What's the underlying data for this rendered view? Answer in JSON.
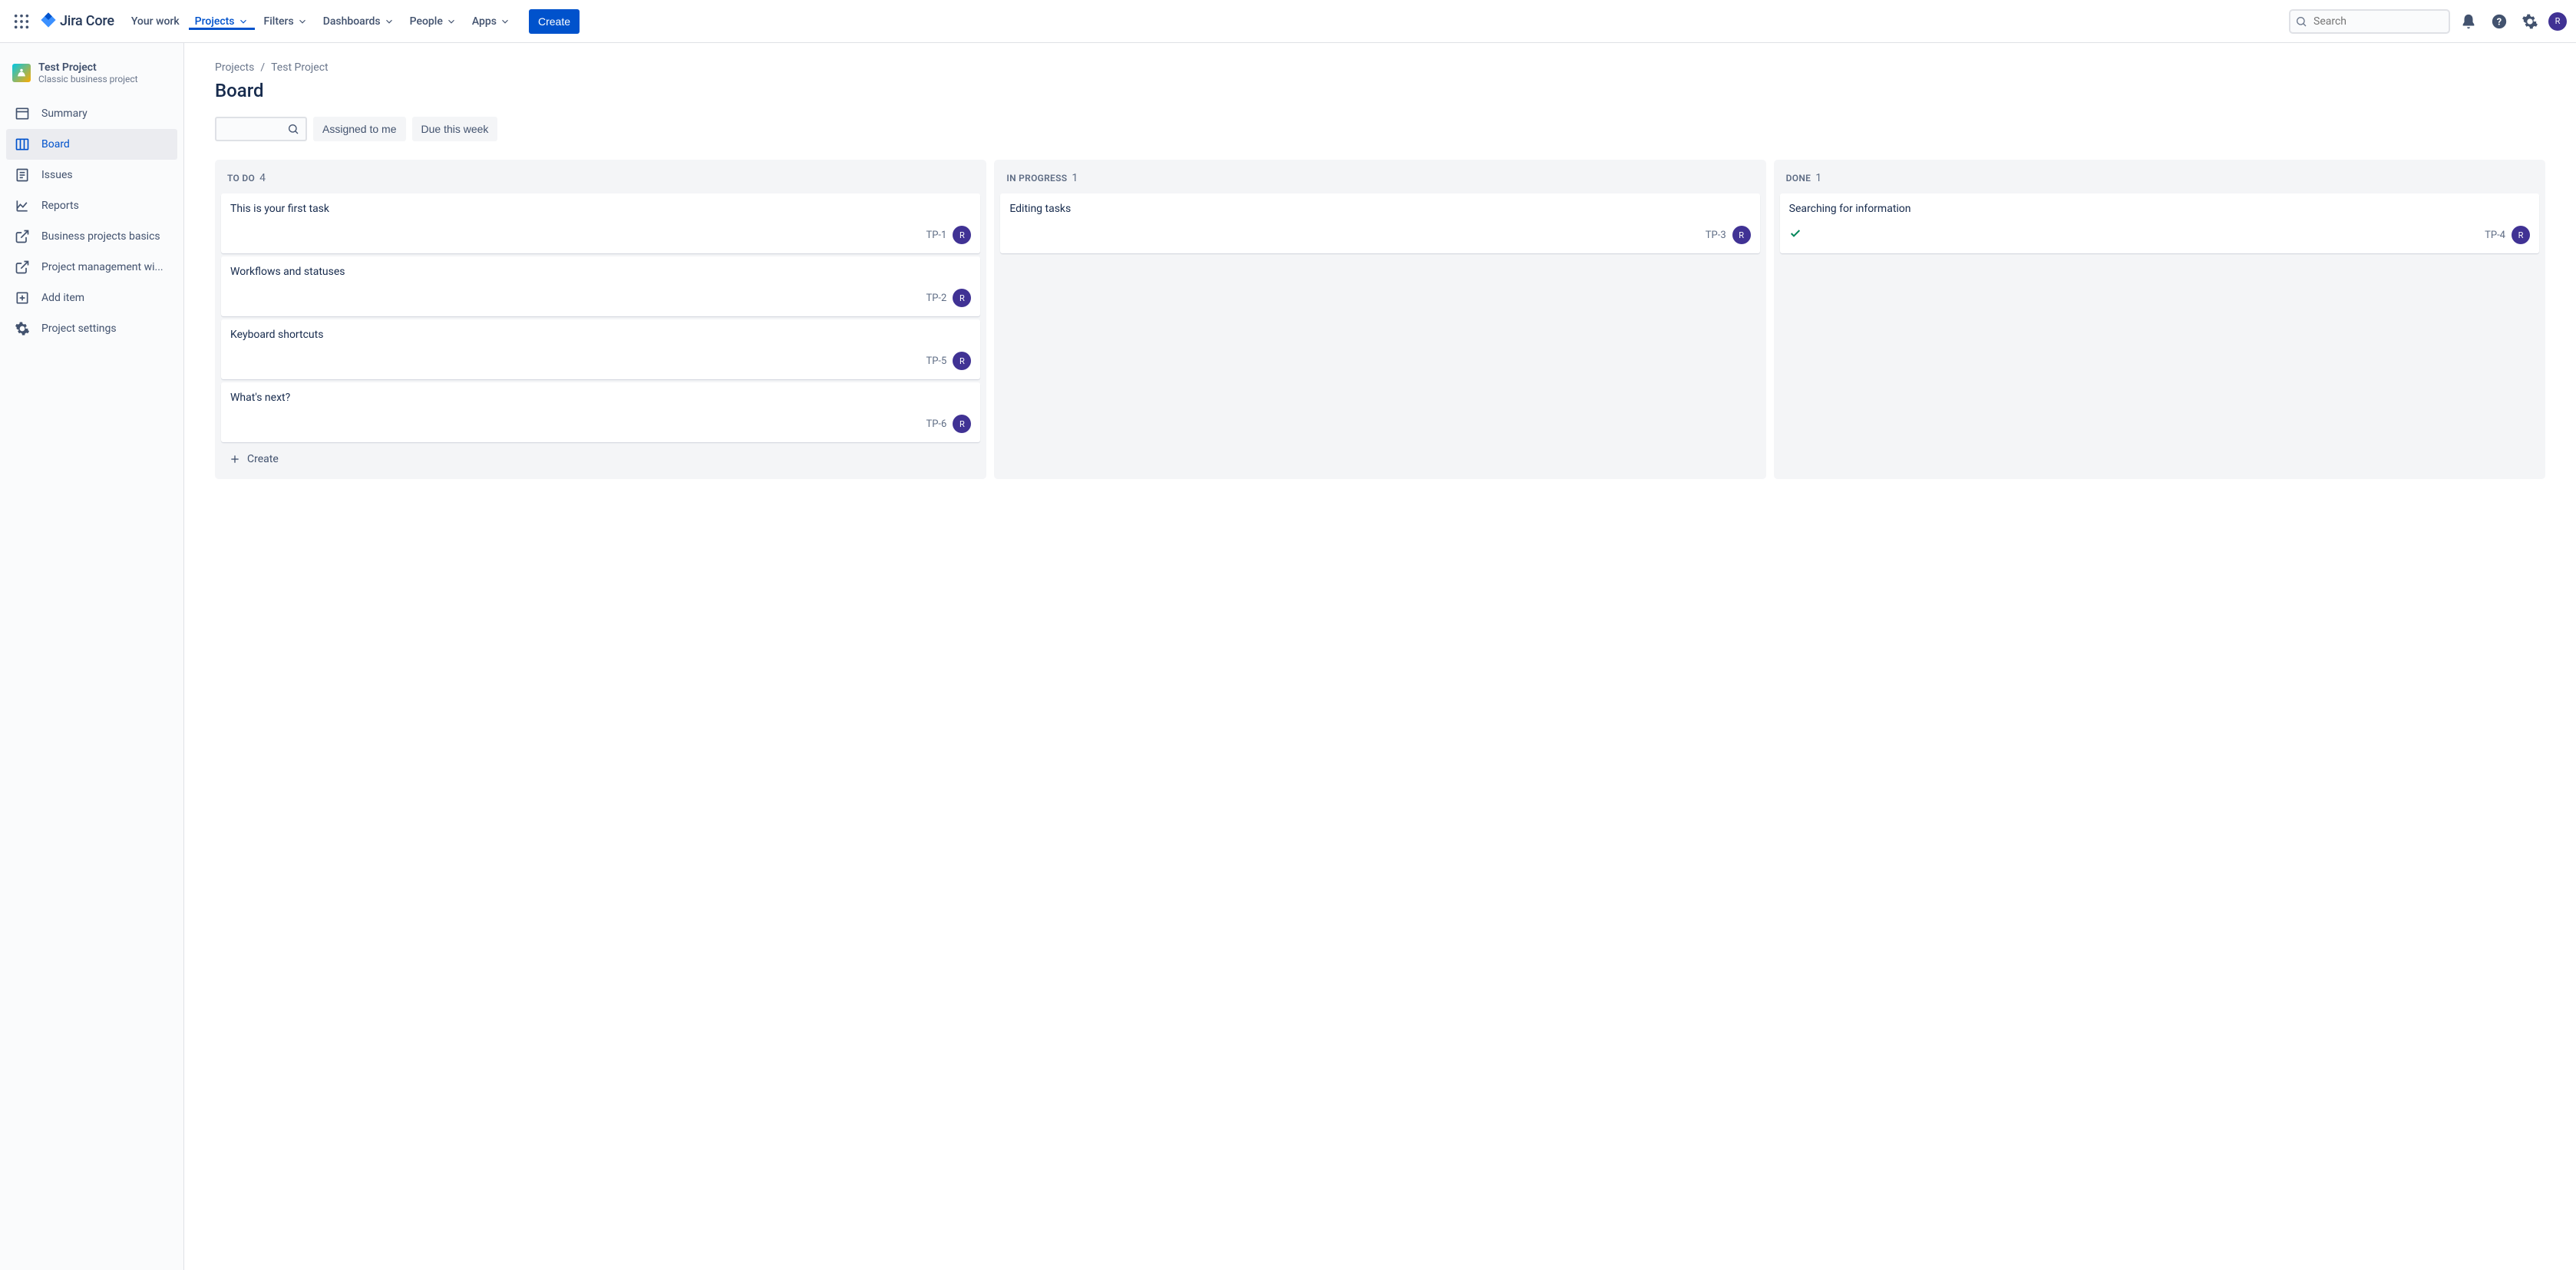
{
  "brand": {
    "name": "Jira Core"
  },
  "topnav": {
    "items": [
      {
        "label": "Your work",
        "dropdown": false
      },
      {
        "label": "Projects",
        "dropdown": true,
        "active": true
      },
      {
        "label": "Filters",
        "dropdown": true
      },
      {
        "label": "Dashboards",
        "dropdown": true
      },
      {
        "label": "People",
        "dropdown": true
      },
      {
        "label": "Apps",
        "dropdown": true
      }
    ],
    "create_label": "Create",
    "search_placeholder": "Search",
    "avatar_initial": "R"
  },
  "sidebar": {
    "project_name": "Test Project",
    "project_subtitle": "Classic business project",
    "items": [
      {
        "label": "Summary",
        "icon": "summary"
      },
      {
        "label": "Board",
        "icon": "board",
        "active": true
      },
      {
        "label": "Issues",
        "icon": "issues"
      },
      {
        "label": "Reports",
        "icon": "reports"
      },
      {
        "label": "Business projects basics",
        "icon": "external"
      },
      {
        "label": "Project management wi...",
        "icon": "external"
      },
      {
        "label": "Add item",
        "icon": "add"
      },
      {
        "label": "Project settings",
        "icon": "settings"
      }
    ]
  },
  "breadcrumb": {
    "root": "Projects",
    "project": "Test Project"
  },
  "page_title": "Board",
  "filters": {
    "assigned_label": "Assigned to me",
    "due_label": "Due this week"
  },
  "board": {
    "columns": [
      {
        "title": "To do",
        "count": 4,
        "show_create": true,
        "cards": [
          {
            "title": "This is your first task",
            "key": "TP-1",
            "assignee": "R"
          },
          {
            "title": "Workflows and statuses",
            "key": "TP-2",
            "assignee": "R"
          },
          {
            "title": "Keyboard shortcuts",
            "key": "TP-5",
            "assignee": "R"
          },
          {
            "title": "What's next?",
            "key": "TP-6",
            "assignee": "R"
          }
        ]
      },
      {
        "title": "In progress",
        "count": 1,
        "cards": [
          {
            "title": "Editing tasks",
            "key": "TP-3",
            "assignee": "R"
          }
        ]
      },
      {
        "title": "Done",
        "count": 1,
        "cards": [
          {
            "title": "Searching for information",
            "key": "TP-4",
            "assignee": "R",
            "done": true
          }
        ]
      }
    ],
    "create_label": "Create"
  }
}
